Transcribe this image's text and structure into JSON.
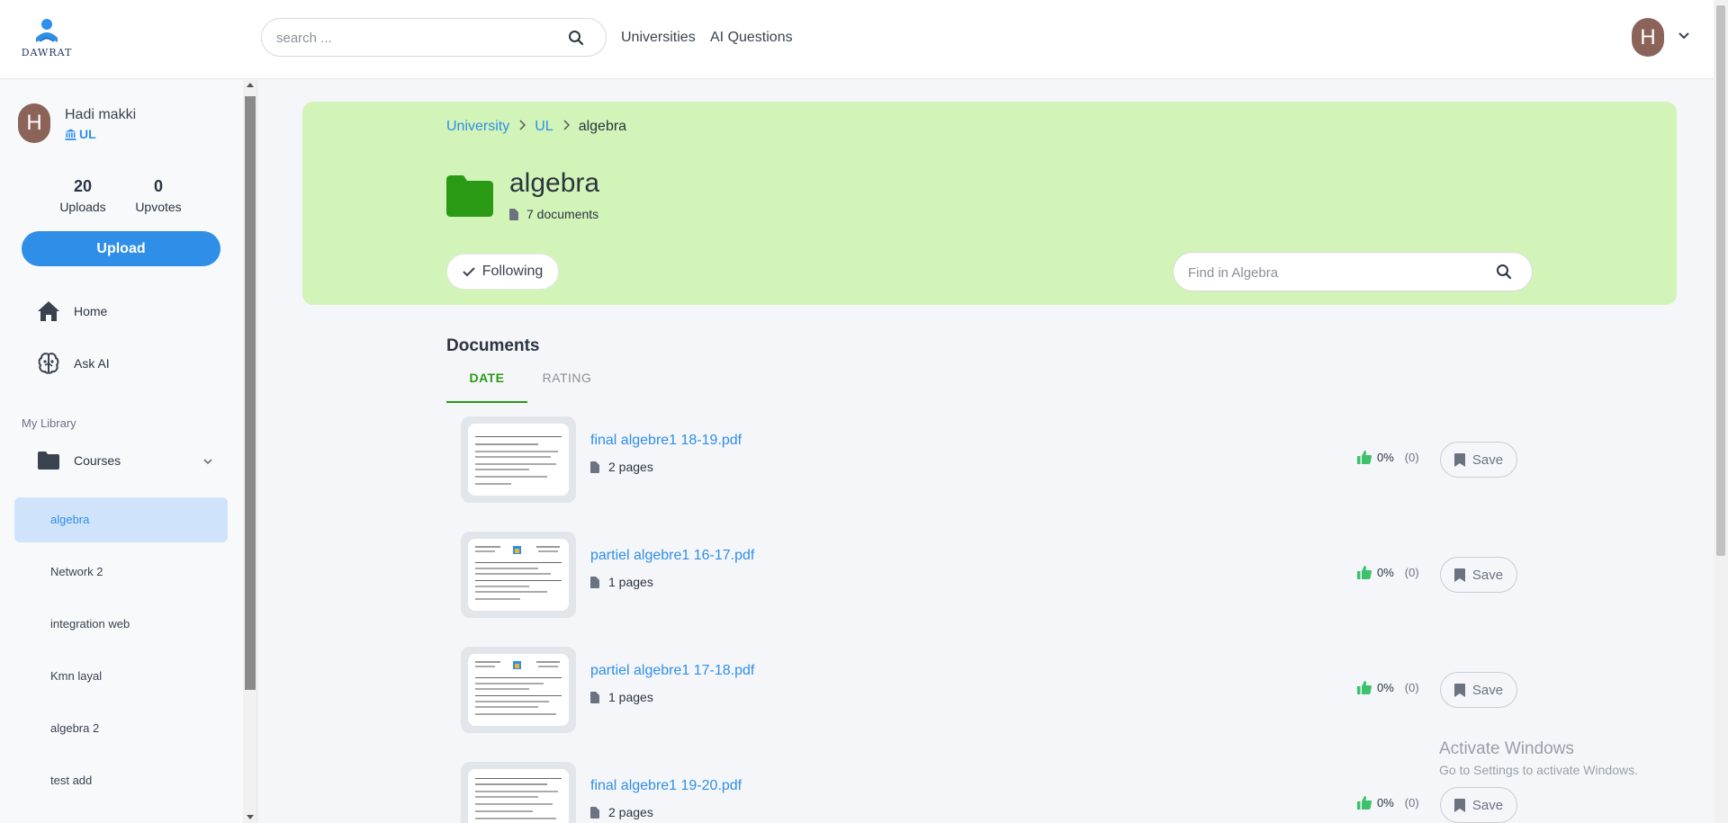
{
  "header": {
    "logo_text": "DAWRAT",
    "search_placeholder": "search ...",
    "nav": [
      "Universities",
      "AI Questions"
    ],
    "avatar_initial": "H"
  },
  "sidebar": {
    "user": {
      "initial": "H",
      "name": "Hadi makki",
      "university": "UL"
    },
    "stats": [
      {
        "value": "20",
        "label": "Uploads"
      },
      {
        "value": "0",
        "label": "Upvotes"
      }
    ],
    "upload_label": "Upload",
    "nav": [
      {
        "label": "Home",
        "icon": "home-icon"
      },
      {
        "label": "Ask AI",
        "icon": "brain-icon"
      }
    ],
    "library_title": "My Library",
    "courses_label": "Courses",
    "courses": [
      "algebra",
      "Network 2",
      "integration web",
      "Kmn layal",
      "algebra 2",
      "test add"
    ],
    "active_course": "algebra"
  },
  "banner": {
    "breadcrumb": [
      "University",
      "UL",
      "algebra"
    ],
    "title": "algebra",
    "doc_count": "7 documents",
    "following_label": "Following",
    "find_placeholder": "Find in Algebra",
    "bg_color": "#d2f4b8"
  },
  "documents": {
    "title": "Documents",
    "tabs": [
      "DATE",
      "RATING"
    ],
    "active_tab": "DATE",
    "items": [
      {
        "name": "final algebre1 18-19.pdf",
        "pages": "2 pages",
        "rating": "0%",
        "count": "(0)",
        "save": "Save"
      },
      {
        "name": "partiel algebre1 16-17.pdf",
        "pages": "1 pages",
        "rating": "0%",
        "count": "(0)",
        "save": "Save"
      },
      {
        "name": "partiel algebre1 17-18.pdf",
        "pages": "1 pages",
        "rating": "0%",
        "count": "(0)",
        "save": "Save"
      },
      {
        "name": "final algebre1 19-20.pdf",
        "pages": "2 pages",
        "rating": "0%",
        "count": "(0)",
        "save": "Save"
      }
    ]
  },
  "watermark": {
    "line1": "Activate Windows",
    "line2": "Go to Settings to activate Windows."
  },
  "colors": {
    "accent": "#2f8fe8",
    "tab_active": "#2a9a14",
    "like": "#3cc26b",
    "avatar": "#8b6358"
  }
}
